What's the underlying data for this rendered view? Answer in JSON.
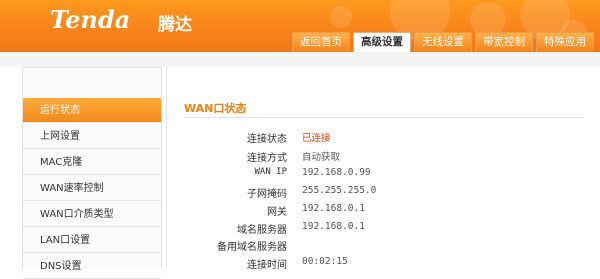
{
  "header": {
    "logo_text": "Tenda",
    "logo_cn": "腾达",
    "tabs": [
      {
        "label": "返回首页",
        "active": false
      },
      {
        "label": "高级设置",
        "active": true
      },
      {
        "label": "无线设置",
        "active": false
      },
      {
        "label": "带宽控制",
        "active": false
      },
      {
        "label": "特殊应用",
        "active": false
      }
    ]
  },
  "sidebar": {
    "items": [
      {
        "label": "运行状态",
        "active": true
      },
      {
        "label": "上网设置",
        "active": false
      },
      {
        "label": "MAC克隆",
        "active": false
      },
      {
        "label": "WAN速率控制",
        "active": false
      },
      {
        "label": "WAN口介质类型",
        "active": false
      },
      {
        "label": "LAN口设置",
        "active": false
      },
      {
        "label": "DNS设置",
        "active": false
      }
    ]
  },
  "wan_status": {
    "title": "WAN口状态",
    "rows": [
      {
        "label": "连接状态",
        "value": "已连接"
      },
      {
        "label": "连接方式",
        "value": "自动获取"
      },
      {
        "label": "WAN IP",
        "value": "192.168.0.99"
      },
      {
        "label": "子网掩码",
        "value": "255.255.255.0"
      },
      {
        "label": "网关",
        "value": "192.168.0.1"
      },
      {
        "label": "域名服务器",
        "value": "192.168.0.1"
      },
      {
        "label": "备用域名服务器",
        "value": ""
      },
      {
        "label": "连接时间",
        "value": "00:02:15"
      }
    ]
  },
  "colors": {
    "brand_orange": "#f7821a",
    "status_connected": "#e8380d"
  }
}
